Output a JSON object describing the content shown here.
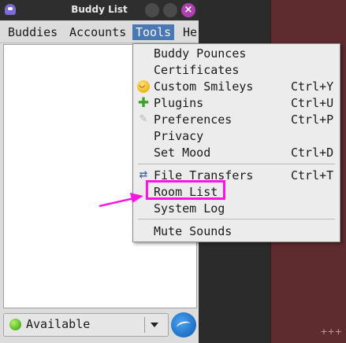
{
  "window": {
    "title": "Buddy List",
    "close_glyph": "×"
  },
  "menubar": {
    "buddies": "Buddies",
    "accounts": "Accounts",
    "tools": "Tools",
    "help": "He"
  },
  "tools_menu": {
    "items": [
      {
        "label": "Buddy Pounces",
        "accel": "",
        "icon": ""
      },
      {
        "label": "Certificates",
        "accel": "",
        "icon": ""
      },
      {
        "label": "Custom Smileys",
        "accel": "Ctrl+Y",
        "icon": "smiley-icon"
      },
      {
        "label": "Plugins",
        "accel": "Ctrl+U",
        "icon": "puzzle-icon"
      },
      {
        "label": "Preferences",
        "accel": "Ctrl+P",
        "icon": "wrench-icon"
      },
      {
        "label": "Privacy",
        "accel": "",
        "icon": ""
      },
      {
        "label": "Set Mood",
        "accel": "Ctrl+D",
        "icon": ""
      },
      {
        "label": "File Transfers",
        "accel": "Ctrl+T",
        "icon": "transfer-arrows-icon"
      },
      {
        "label": "Room List",
        "accel": "",
        "icon": ""
      },
      {
        "label": "System Log",
        "accel": "",
        "icon": ""
      },
      {
        "label": "Mute Sounds",
        "accel": "",
        "icon": ""
      }
    ]
  },
  "icon_glyphs": {
    "plugins": "✚",
    "preferences": "✎",
    "transfers": "⇄"
  },
  "status": {
    "label": "Available"
  },
  "background": {
    "corner_text": "+++"
  },
  "colors": {
    "highlight": "#ff14e6",
    "menu_selected": "#4a78b5",
    "maroon_panel": "#5e2b2e"
  }
}
